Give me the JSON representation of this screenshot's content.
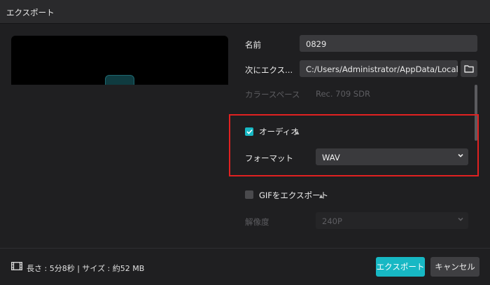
{
  "window": {
    "title": "エクスポート"
  },
  "form": {
    "name_label": "名前",
    "name_value": "0829",
    "export_to_label": "次にエクス...",
    "export_path": "C:/Users/Administrator/AppData/Local/C...",
    "color_space_label": "カラースペース",
    "color_space_value": "Rec. 709 SDR"
  },
  "audio": {
    "label": "オーディオ",
    "checked": true,
    "format_label": "フォーマット",
    "format_value": "WAV"
  },
  "gif": {
    "label": "GIFをエクスポート",
    "checked": false,
    "resolution_label": "解像度",
    "resolution_value": "240P"
  },
  "footer": {
    "info": "長さ : 5分8秒 | サイズ : 約52 MB",
    "export_label": "エクスポート",
    "cancel_label": "キャンセル"
  },
  "colors": {
    "accent": "#17b8c4",
    "highlight": "#e12121"
  }
}
